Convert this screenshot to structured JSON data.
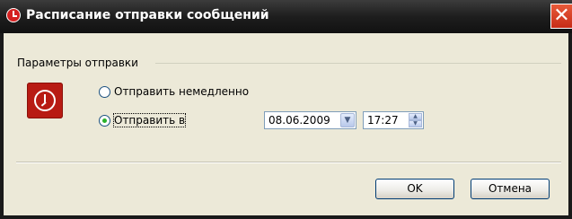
{
  "window": {
    "title": "Расписание отправки сообщений",
    "close_glyph": "✕"
  },
  "group": {
    "legend": "Параметры отправки"
  },
  "options": {
    "send_now_label": "Отправить немедленно",
    "send_at_label": "Отправить в",
    "selected": "send_at"
  },
  "schedule": {
    "date": "08.06.2009",
    "time": "17:27"
  },
  "buttons": {
    "ok": "OK",
    "cancel": "Отмена"
  },
  "colors": {
    "title_bar": "#1e1e1e",
    "dialog_bg": "#ece9d8",
    "icon_red": "#b81b13",
    "close_red": "#c72c16"
  }
}
